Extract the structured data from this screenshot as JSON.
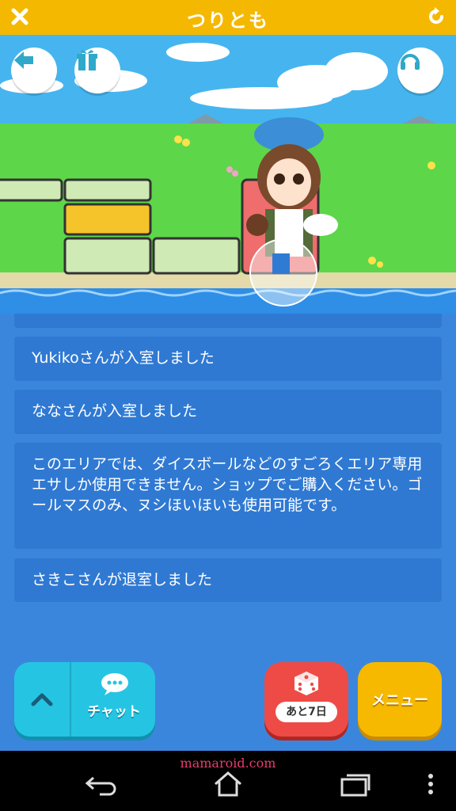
{
  "topbar": {
    "title": "つりとも",
    "close_icon": "close-icon",
    "reload_icon": "reload-icon"
  },
  "scene": {
    "back_icon": "back-arrow-icon",
    "gift_icon": "gift-icon",
    "headset_icon": "headset-icon",
    "sky_color": "#46b5ef",
    "grass_color": "#5dd64a",
    "water_color": "#2f8ee6"
  },
  "chat": {
    "messages": [
      {
        "text": "Yukikoさんが入室しました"
      },
      {
        "text": "ななさんが入室しました"
      },
      {
        "text": "このエリアでは、ダイスボールなどのすごろくエリア専用エサしか使用できません。ショップでご購入ください。ゴールマスのみ、ヌシほいほいも使用可能です。"
      },
      {
        "text": "さきこさんが退室しました"
      }
    ]
  },
  "bottom": {
    "chat_label": "チャット",
    "dice_label": "あと7日",
    "menu_label": "メニュー"
  },
  "navbar": {
    "watermark": "mamaroid.com"
  },
  "colors": {
    "accent": "#f5b800",
    "chat_bg": "#3b86dd",
    "message_bg": "#2f79d3"
  }
}
